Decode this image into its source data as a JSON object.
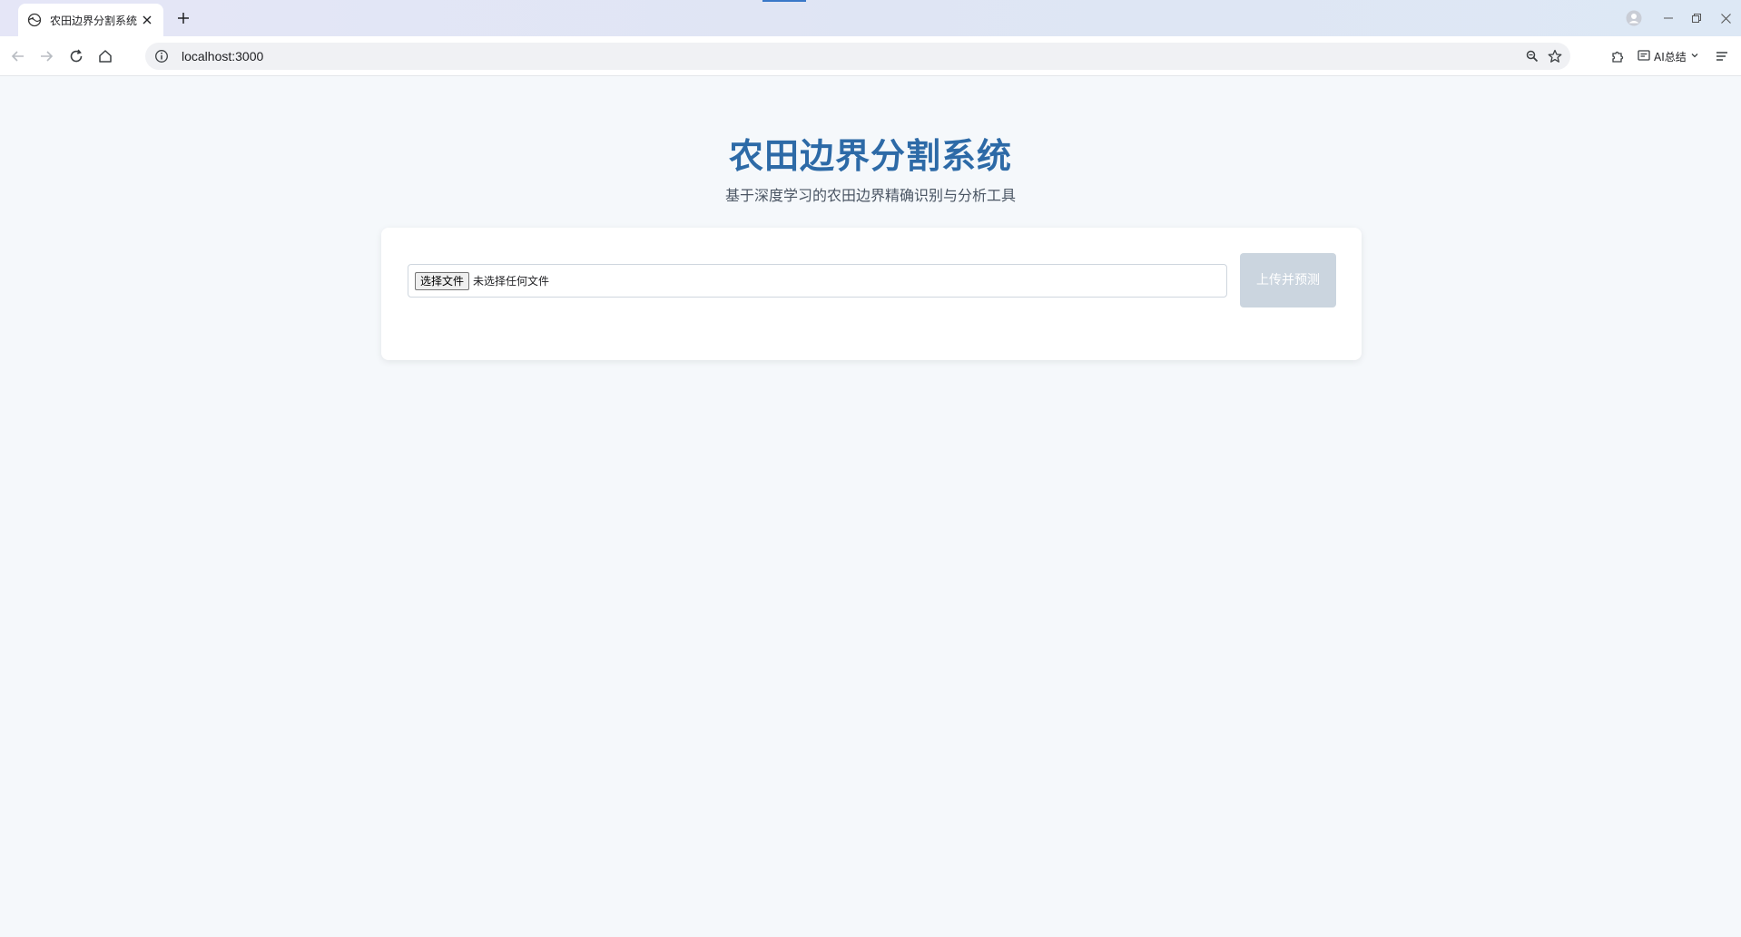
{
  "browser": {
    "tab": {
      "title": "农田边界分割系统",
      "favicon": "web-favicon-icon"
    },
    "url": "localhost:3000",
    "ai_summary_label": "AI总结",
    "icons": {
      "back": "back-arrow-icon",
      "forward": "forward-arrow-icon",
      "reload": "reload-icon",
      "home": "home-icon",
      "info": "info-icon",
      "zoom": "zoom-icon",
      "bookmark": "star-icon",
      "extensions": "puzzle-icon",
      "menu": "menu-icon",
      "profile": "profile-icon"
    }
  },
  "page": {
    "title": "农田边界分割系统",
    "subtitle": "基于深度学习的农田边界精确识别与分析工具",
    "upload": {
      "choose_file_label": "选择文件",
      "no_file_text": "未选择任何文件",
      "submit_label": "上传并预测"
    }
  },
  "colors": {
    "title": "#2d6aa7",
    "page_background": "#f5f8fb",
    "submit_disabled": "#cbd5df"
  }
}
